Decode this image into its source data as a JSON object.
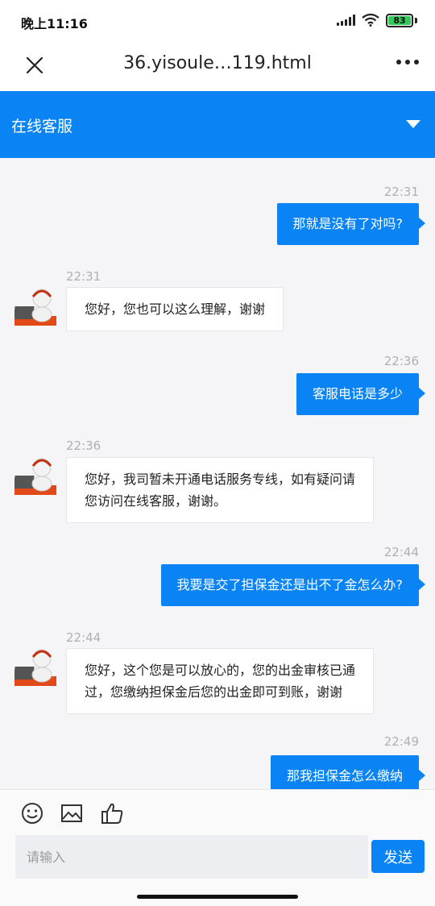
{
  "status_bar": {
    "time": "晚上11:16",
    "battery": "83"
  },
  "browser": {
    "url_title": "36.yisoule…119.html"
  },
  "header": {
    "title": "在线客服"
  },
  "messages": [
    {
      "side": "right",
      "time": "22:31",
      "text": "那就是没有了对吗?"
    },
    {
      "side": "left",
      "time": "22:31",
      "text": "您好，您也可以这么理解，谢谢"
    },
    {
      "side": "right",
      "time": "22:36",
      "text": "客服电话是多少"
    },
    {
      "side": "left",
      "time": "22:36",
      "lines": [
        "您好，我司暂未开通电话服务专线，如有疑问请",
        "您访问在线客服，谢谢。"
      ]
    },
    {
      "side": "right",
      "time": "22:44",
      "text": "我要是交了担保金还是出不了金怎么办?"
    },
    {
      "side": "left",
      "time": "22:44",
      "lines": [
        "您好，这个您是可以放心的，您的出金审核已通",
        "过，您缴纳担保金后您的出金即可到账，谢谢"
      ]
    },
    {
      "side": "right",
      "time": "22:49",
      "text": "那我担保金怎么缴纳"
    }
  ],
  "input": {
    "placeholder": "请输入",
    "send_label": "发送"
  },
  "icons": [
    "emoji-icon",
    "image-icon",
    "thumbs-up-icon"
  ],
  "colors": {
    "accent": "#0a84f5",
    "battery": "#34c759"
  }
}
